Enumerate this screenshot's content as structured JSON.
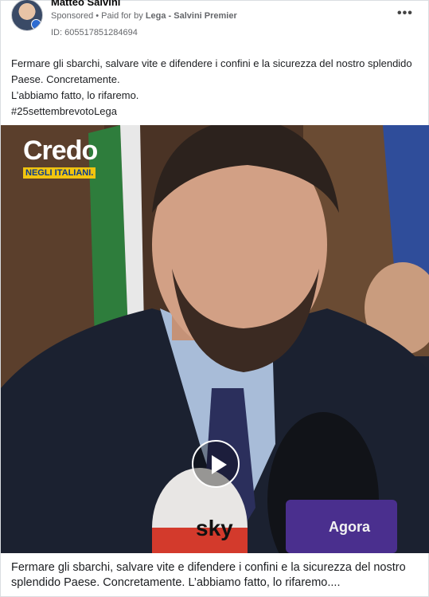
{
  "header": {
    "page_name": "Matteo Salvini",
    "sponsored": "Sponsored",
    "paid_prefix": " • Paid for by ",
    "payer": "Lega - Salvini Premier",
    "ad_id": "ID: 605517851284694",
    "more_icon": "more-options-icon"
  },
  "body_text": {
    "line1": "Fermare gli sbarchi, salvare vite e difendere i confini e la sicurezza del nostro splendido Paese. Concretamente.",
    "line2": "L’abbiamo fatto, lo rifaremo.",
    "line3": "#25settembrevotoLega"
  },
  "video": {
    "logo_main": "Credo",
    "logo_sub": "NEGLI ITALIANI.",
    "mic_label_left": "sky",
    "mic_label_right": "Agora",
    "play_icon": "play-icon"
  },
  "caption": "Fermare gli sbarchi, salvare vite e difendere i confini e la sicurezza del nostro splendido Paese. Concretamente. L’abbiamo fatto, lo rifaremo....",
  "colors": {
    "logo_sub_bg": "#f1c40f",
    "logo_sub_text": "#0b3b8c",
    "meta_text": "#65676b"
  }
}
